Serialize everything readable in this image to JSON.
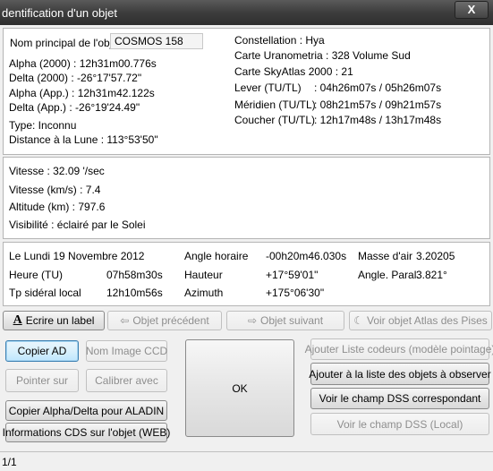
{
  "window": {
    "title": "dentification d'un objet",
    "close_symbol": "X"
  },
  "object": {
    "name_label": "Nom principal de l'objet",
    "name_value": "COSMOS 158",
    "alpha_2000": "Alpha (2000) : 12h31m00.776s",
    "delta_2000": "Delta (2000) : -26°17'57.72\"",
    "alpha_app": "Alpha (App.) : 12h31m42.122s",
    "delta_app": "Delta (App.) : -26°19'24.49\"",
    "type": "Type: Inconnu",
    "distance_moon": "Distance à la Lune : 113°53'50\"",
    "constellation": "Constellation :  Hya",
    "uranometria": "Carte Uranometria : 328  Volume Sud",
    "skyatlas": "Carte SkyAtlas 2000 : 21",
    "lever_label": "Lever     (TU/TL)",
    "lever_value": ": 04h26m07s / 05h26m07s",
    "meridien_label": "Méridien (TU/TL)",
    "meridien_value": ": 08h21m57s / 09h21m57s",
    "coucher_label": "Coucher (TU/TL)",
    "coucher_value": ": 12h17m48s / 13h17m48s"
  },
  "satellite": {
    "vitesse": "Vitesse :  32.09 '/sec",
    "vitesse_kms": "Vitesse (km/s) :  7.4",
    "altitude": "Altitude (km) :  797.6",
    "visibilite": "Visibilité : éclairé par le Solei"
  },
  "position": {
    "date": "Le Lundi 19 Novembre 2012",
    "heure_label": "Heure (TU)",
    "heure_value": "07h58m30s",
    "tsl_label": "Tp sidéral local",
    "tsl_value": "12h10m56s",
    "angle_horaire_label": "Angle horaire",
    "angle_horaire_value": "-00h20m46.030s",
    "hauteur_label": "Hauteur",
    "hauteur_value": "+17°59'01\"",
    "azimuth_label": "Azimuth",
    "azimuth_value": "+175°06'30\"",
    "masse_air_label": "Masse d'air",
    "masse_air_value": "3.20205",
    "angle_paral_label": "Angle. Paral.",
    "angle_paral_value": "3.821°"
  },
  "buttons": {
    "ecrire_label": "Ecrire un label",
    "objet_precedent": "Objet précédent",
    "objet_suivant": "Objet suivant",
    "voir_atlas": "Voir objet Atlas des Pises",
    "copier_ad": "Copier AD",
    "nom_image_ccd": "Nom Image CCD",
    "pointer_sur": "Pointer sur",
    "calibrer_avec": "Calibrer avec",
    "copier_aladin": "Copier Alpha/Delta pour ALADIN",
    "infos_cds": "Informations CDS sur l'objet (WEB)",
    "ok": "OK",
    "ajouter_codeurs": "Ajouter Liste codeurs (modèle pointage)",
    "ajouter_observer": "Ajouter à la liste des objets à observer",
    "voir_dss": "Voir le champ DSS correspondant",
    "voir_dss_local": "Voir le champ DSS (Local)"
  },
  "status": {
    "page": "1/1"
  }
}
